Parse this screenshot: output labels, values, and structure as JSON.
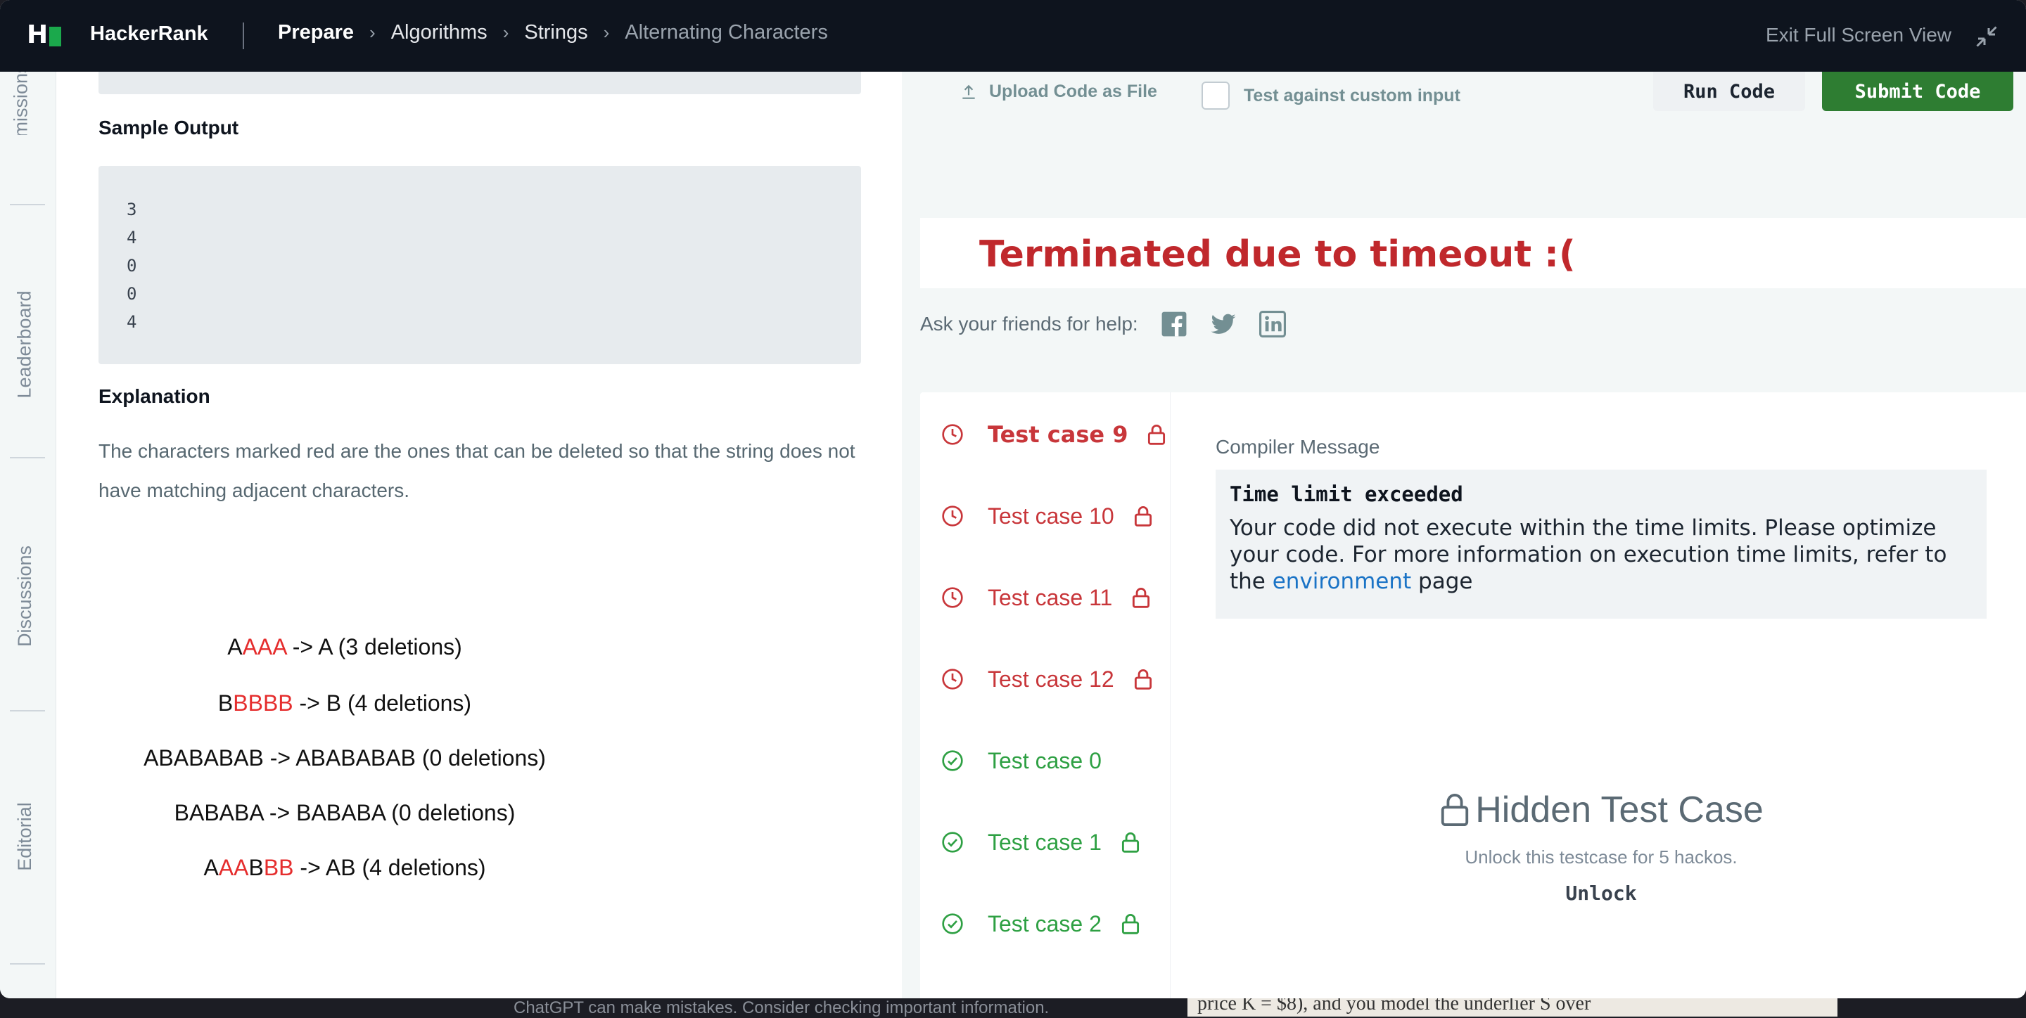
{
  "topbar": {
    "brand": "HackerRank",
    "breadcrumbs": [
      "Prepare",
      "Algorithms",
      "Strings",
      "Alternating Characters"
    ],
    "exit_fullscreen": "Exit Full Screen View"
  },
  "side_tabs": [
    "Submissions",
    "Leaderboard",
    "Discussions",
    "Editorial"
  ],
  "problem": {
    "sample_output_heading": "Sample Output",
    "sample_output": [
      "3",
      "4",
      "0",
      "0",
      "4"
    ],
    "explanation_heading": "Explanation",
    "explanation_text": "The characters marked red are the ones that can be deleted so that the string does not have matching adjacent characters.",
    "examples": [
      {
        "parts": [
          {
            "t": "A",
            "red": false
          },
          {
            "t": "AAA",
            "red": true
          },
          {
            "t": " -> A (3 deletions)",
            "red": false
          }
        ]
      },
      {
        "parts": [
          {
            "t": "B",
            "red": false
          },
          {
            "t": "BBBB",
            "red": true
          },
          {
            "t": " -> B (4 deletions)",
            "red": false
          }
        ]
      },
      {
        "parts": [
          {
            "t": "ABABABAB -> ABABABAB (0 deletions)",
            "red": false
          }
        ]
      },
      {
        "parts": [
          {
            "t": "BABABA -> BABABA (0 deletions)",
            "red": false
          }
        ]
      },
      {
        "parts": [
          {
            "t": "A",
            "red": false
          },
          {
            "t": "AA",
            "red": true
          },
          {
            "t": "B",
            "red": false
          },
          {
            "t": "BB",
            "red": true
          },
          {
            "t": " -> AB (4 deletions)",
            "red": false
          }
        ]
      }
    ]
  },
  "editor_actions": {
    "upload_label": "Upload Code as File",
    "custom_input_label": "Test against custom input",
    "run_label": "Run Code",
    "submit_label": "Submit Code"
  },
  "result": {
    "status": "Terminated due to timeout :(",
    "help_label": "Ask your friends for help:",
    "social": [
      "facebook-icon",
      "twitter-icon",
      "linkedin-icon"
    ]
  },
  "test_cases": [
    {
      "label": "Test case 9",
      "status": "fail",
      "locked": true,
      "active": true
    },
    {
      "label": "Test case 10",
      "status": "fail",
      "locked": true,
      "active": false
    },
    {
      "label": "Test case 11",
      "status": "fail",
      "locked": true,
      "active": false
    },
    {
      "label": "Test case 12",
      "status": "fail",
      "locked": true,
      "active": false
    },
    {
      "label": "Test case 0",
      "status": "pass",
      "locked": false,
      "active": false
    },
    {
      "label": "Test case 1",
      "status": "pass",
      "locked": true,
      "active": false
    },
    {
      "label": "Test case 2",
      "status": "pass",
      "locked": true,
      "active": false
    }
  ],
  "compiler": {
    "label": "Compiler Message",
    "title": "Time limit exceeded",
    "text_before": "Your code did not execute within the time limits. Please optimize your code. For more information on execution time limits, refer to the ",
    "link": "environment",
    "text_after": " page"
  },
  "hidden_case": {
    "title": "Hidden Test Case",
    "note": "Unlock this testcase for 5 hackos.",
    "unlock_label": "Unlock"
  },
  "background": {
    "note": "ChatGPT can make mistakes. Consider checking important information.",
    "paper_snippet": "price K = $8), and you model the underlier S over"
  },
  "colors": {
    "fail": "#c8363a",
    "pass": "#2ea043",
    "submit": "#2e7d32",
    "brand_green": "#1ba94c",
    "navbar": "#0e141e"
  }
}
